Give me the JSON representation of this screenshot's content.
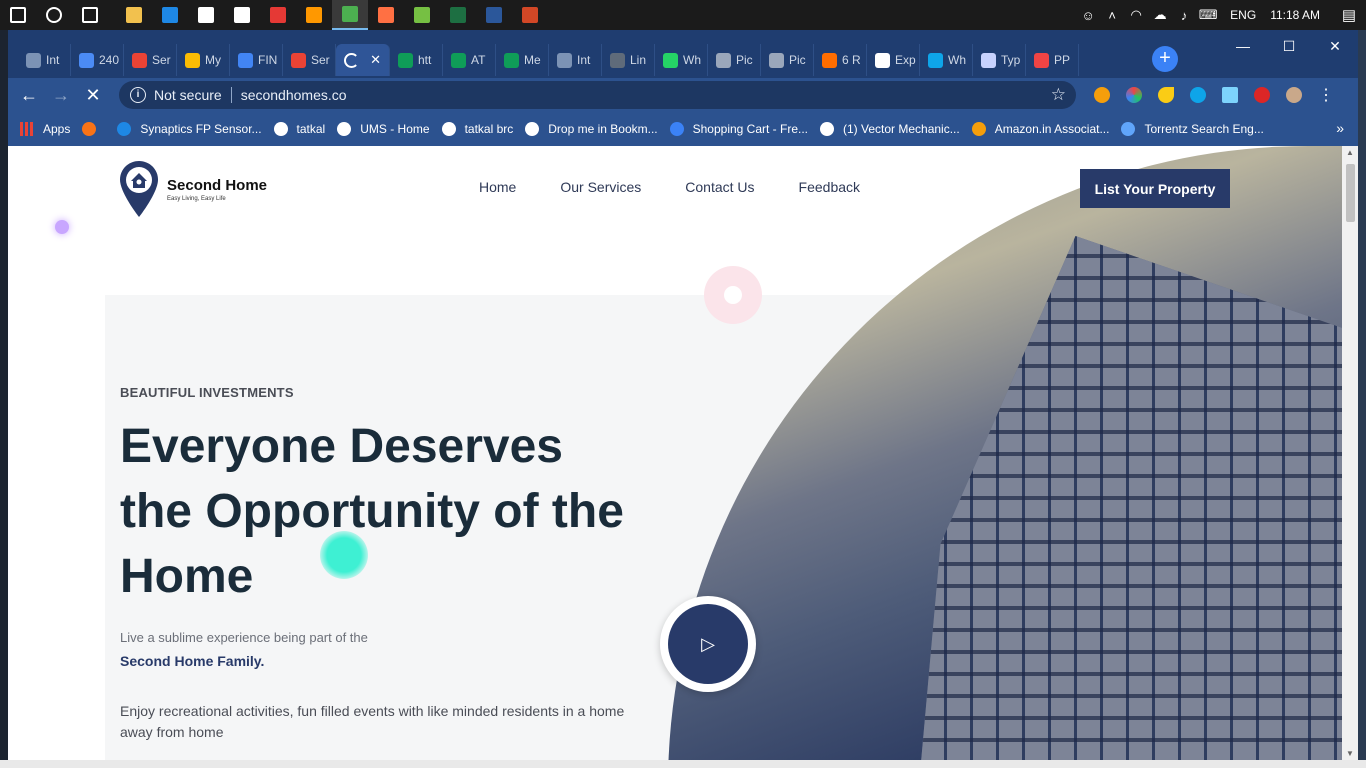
{
  "taskbar": {
    "icons": [
      {
        "name": "windows-start-icon",
        "color": "#ffffff"
      },
      {
        "name": "cortana-icon",
        "color": "#ffffff"
      },
      {
        "name": "task-view-icon",
        "color": "#ffffff"
      },
      {
        "name": "file-explorer-icon",
        "color": "#f2c14e"
      },
      {
        "name": "edge-icon",
        "color": "#1e88e5"
      },
      {
        "name": "store-icon",
        "color": "#ffffff"
      },
      {
        "name": "mail-icon",
        "color": "#ffffff"
      },
      {
        "name": "pocketcasts-icon",
        "color": "#e53935"
      },
      {
        "name": "sublime-icon",
        "color": "#ff9800"
      },
      {
        "name": "chrome-icon",
        "color": "#4caf50"
      },
      {
        "name": "firefox-icon",
        "color": "#ff7043"
      },
      {
        "name": "utorrent-icon",
        "color": "#76c043"
      },
      {
        "name": "excel-icon",
        "color": "#1d6f42"
      },
      {
        "name": "word-icon",
        "color": "#2b579a"
      },
      {
        "name": "powerpoint-icon",
        "color": "#d24726"
      }
    ],
    "tray": {
      "lang": "ENG",
      "time": "11:18 AM"
    }
  },
  "tabs": [
    {
      "label": "Int",
      "color": "#7c93b5"
    },
    {
      "label": "240",
      "color": "#4b8bf5"
    },
    {
      "label": "Ser",
      "color": "#ea4335"
    },
    {
      "label": "My",
      "color": "#fbbc04"
    },
    {
      "label": "FIN",
      "color": "#4285f4"
    },
    {
      "label": "Ser",
      "color": "#ea4335"
    },
    {
      "label": "",
      "color": "#ffffff"
    },
    {
      "label": "htt",
      "color": "#0f9d58"
    },
    {
      "label": "AT",
      "color": "#0f9d58"
    },
    {
      "label": "Me",
      "color": "#0f9d58"
    },
    {
      "label": "Int",
      "color": "#7c93b5"
    },
    {
      "label": "Lin",
      "color": "#5f6b7a"
    },
    {
      "label": "Wh",
      "color": "#25d366"
    },
    {
      "label": "Pic",
      "color": "#9aa7bb"
    },
    {
      "label": "Pic",
      "color": "#9aa7bb"
    },
    {
      "label": "6 R",
      "color": "#ff6d00"
    },
    {
      "label": "Exp",
      "color": "#ffffff"
    },
    {
      "label": "Wh",
      "color": "#0ea5e9"
    },
    {
      "label": "Typ",
      "color": "#c7d2fe"
    },
    {
      "label": "PP",
      "color": "#ef4444"
    }
  ],
  "omnibox": {
    "security": "Not secure",
    "url": "secondhomes.co"
  },
  "bookmarks": [
    {
      "label": "Apps",
      "color": "#ea4335"
    },
    {
      "label": "",
      "color": "#f97316"
    },
    {
      "label": "Synaptics FP Sensor...",
      "color": "#1e88e5"
    },
    {
      "label": "tatkal",
      "color": "#ffffff"
    },
    {
      "label": "UMS - Home",
      "color": "#ffffff"
    },
    {
      "label": "tatkal brc",
      "color": "#ffffff"
    },
    {
      "label": "Drop me in Bookm...",
      "color": "#ffffff"
    },
    {
      "label": "Shopping Cart - Fre...",
      "color": "#3b82f6"
    },
    {
      "label": "(1) Vector Mechanic...",
      "color": "#ffffff"
    },
    {
      "label": "Amazon.in Associat...",
      "color": "#f59e0b"
    },
    {
      "label": "Torrentz Search Eng...",
      "color": "#60a5fa"
    }
  ],
  "site": {
    "brand": "Second Home",
    "tagline": "Easy Living, Easy Life",
    "nav": [
      "Home",
      "Our Services",
      "Contact Us",
      "Feedback"
    ],
    "cta": "List Your Property",
    "eyebrow": "BEAUTIFUL INVESTMENTS",
    "headline": "Everyone Deserves the Opportunity of the Home",
    "sub1": "Live a sublime experience being part of the",
    "sub2": "Second Home Family.",
    "body": "Enjoy recreational activities, fun filled events with like minded residents in a home away from home",
    "accent": "#283a69"
  }
}
